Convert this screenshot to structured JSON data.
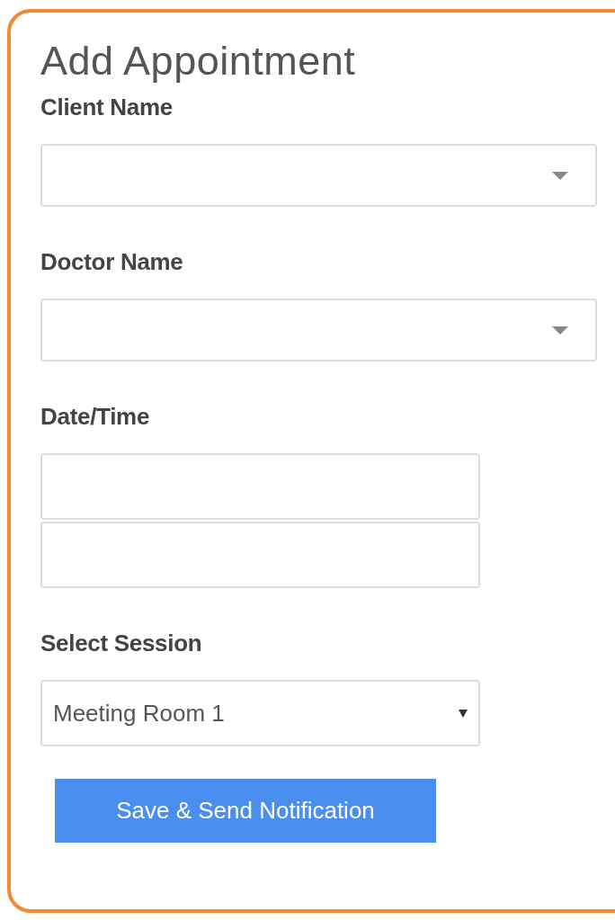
{
  "title": "Add Appointment",
  "fields": [
    {
      "kind": "combo",
      "label": "Client Name"
    },
    {
      "kind": "combo",
      "label": "Doctor Name"
    },
    {
      "kind": "datetime",
      "label": "Date/Time"
    },
    {
      "kind": "select",
      "label": "Select Session",
      "value": "Meeting Room 1"
    }
  ],
  "submit": {
    "label": "Save & Send Notification"
  }
}
